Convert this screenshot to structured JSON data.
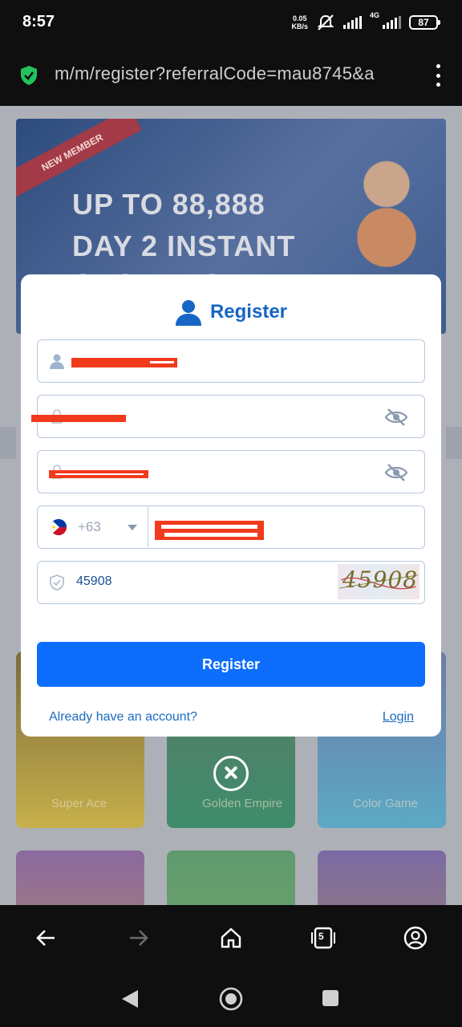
{
  "status_bar": {
    "time": "8:57",
    "net_speed_value": "0.05",
    "net_speed_unit": "KB/s",
    "network_type": "4G",
    "battery": "87"
  },
  "browser": {
    "url": "m/m/register?referralCode=mau8745&a",
    "open_tabs": "5"
  },
  "background_page": {
    "banner_ribbon": "NEW MEMBER",
    "banner_line1": "UP TO 88,888",
    "banner_line2": "DAY 2 INSTANT",
    "banner_line3": "CASHBACK",
    "games": [
      "Super Ace",
      "Golden Empire",
      "Color Game"
    ]
  },
  "register_form": {
    "title": "Register",
    "country_code": "+63",
    "verification_code": "45908",
    "captcha_text": "45908",
    "submit_label": "Register",
    "already_text": "Already have an account?",
    "login_link": "Login"
  },
  "colors": {
    "accent": "#0d6efd",
    "title": "#1666c5",
    "link": "#1c6bbf"
  }
}
